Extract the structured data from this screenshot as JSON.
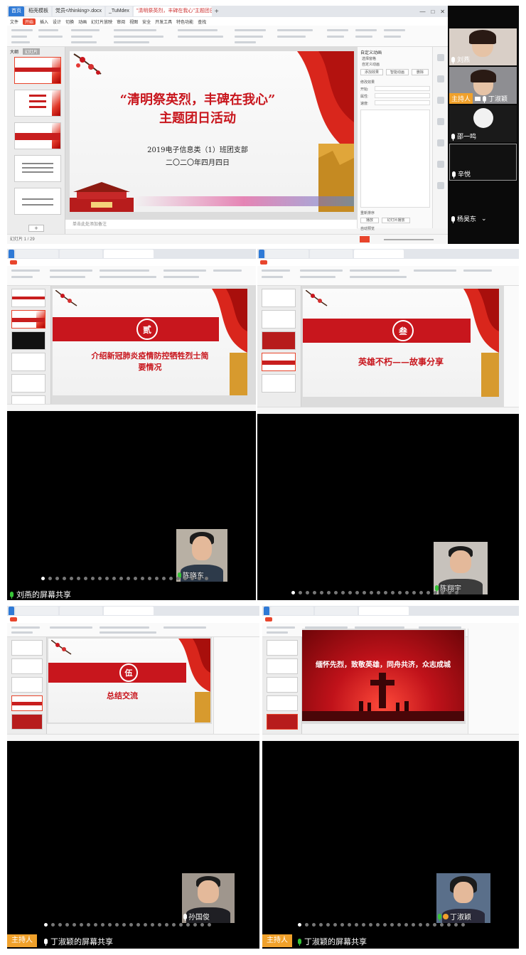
{
  "top": {
    "tabs": [
      "首页",
      "稻壳模板",
      "党员</thinking>.docx",
      "_TuMdex",
      "\"清明祭英烈，丰碑在我心\"主题团日活动.pptx"
    ],
    "menus": [
      "文件",
      "开始",
      "插入",
      "设计",
      "切换",
      "动画",
      "幻灯片放映",
      "审阅",
      "视图",
      "安全",
      "开发工具",
      "特色功能",
      "查找"
    ],
    "outline_tabs": [
      "大纲",
      "幻灯片"
    ],
    "slide": {
      "title_line1": "“清明祭英烈，丰碑在我心”",
      "title_line2": "主题团日活动",
      "org": "2019电子信息类（1）班团支部",
      "date": "二〇二〇年四月四日"
    },
    "status_left": "幻灯片 1 / 29",
    "status_notes": "单击此处添加备注",
    "right_pane": {
      "heading": "自定义动画",
      "labels": [
        "选择窗格",
        "自定义动画",
        "添加效果",
        "智能动画",
        "删除",
        "修改效果",
        "开始:",
        "属性:",
        "速度:",
        "重新排序",
        "播放",
        "幻灯片播放",
        "自动预览"
      ]
    },
    "participants": [
      {
        "name": "刘燕"
      },
      {
        "name": "丁淑颖",
        "badge": "主持人"
      },
      {
        "name": "邵一鸣"
      },
      {
        "name": "辛悦"
      },
      {
        "name": "杨昊东"
      }
    ]
  },
  "panels": [
    {
      "circle": "贰",
      "text_line1": "介绍新冠肺炎疫情防控牺牲烈士简",
      "text_line2": "要情况",
      "video_name": "陈晓东",
      "share_label": "刘燕的屏幕共享",
      "host_badge": ""
    },
    {
      "circle": "叁",
      "text_line1": "英雄不朽——故事分享",
      "text_line2": "",
      "video_name": "陈翔宇",
      "share_label": "",
      "host_badge": ""
    },
    {
      "circle": "伍",
      "text_line1": "总结交流",
      "text_line2": "",
      "video_name": "孙国俊",
      "share_label": "丁淑颖的屏幕共享",
      "host_badge": "主持人"
    },
    {
      "circle": "",
      "text_line1": "缅怀先烈，致敬英雄，同舟共济，众志成城",
      "text_line2": "",
      "video_name": "丁淑颖",
      "share_label": "丁淑颖的屏幕共享",
      "host_badge": "主持人"
    }
  ]
}
